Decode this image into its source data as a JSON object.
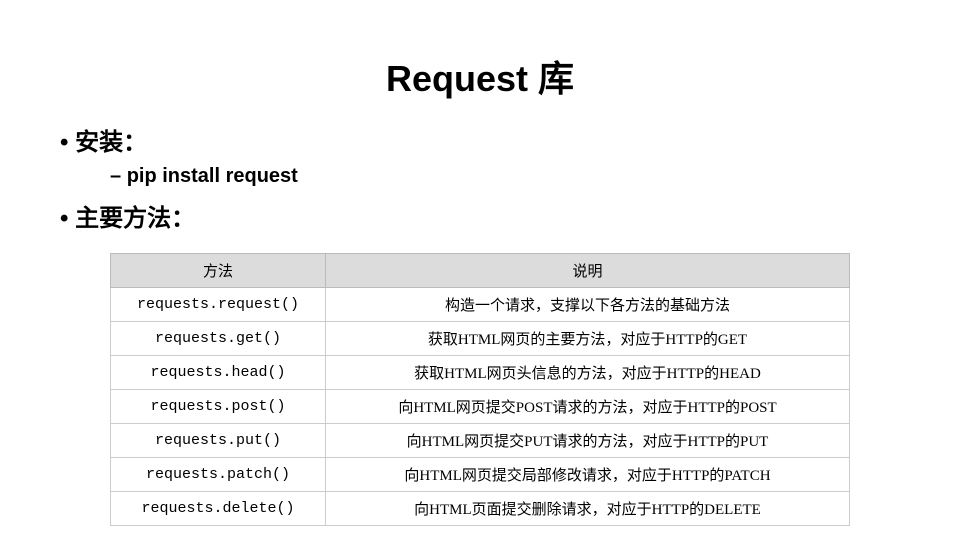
{
  "title": "Request 库",
  "bullets": {
    "install_label": "安装：",
    "install_cmd": "pip install request",
    "methods_label": "主要方法："
  },
  "table": {
    "headers": {
      "method": "方法",
      "desc": "说明"
    },
    "rows": [
      {
        "method": "requests.request()",
        "desc": "构造一个请求，支撑以下各方法的基础方法"
      },
      {
        "method": "requests.get()",
        "desc": "获取HTML网页的主要方法，对应于HTTP的GET"
      },
      {
        "method": "requests.head()",
        "desc": "获取HTML网页头信息的方法，对应于HTTP的HEAD"
      },
      {
        "method": "requests.post()",
        "desc": "向HTML网页提交POST请求的方法，对应于HTTP的POST"
      },
      {
        "method": "requests.put()",
        "desc": "向HTML网页提交PUT请求的方法，对应于HTTP的PUT"
      },
      {
        "method": "requests.patch()",
        "desc": "向HTML网页提交局部修改请求，对应于HTTP的PATCH"
      },
      {
        "method": "requests.delete()",
        "desc": "向HTML页面提交删除请求，对应于HTTP的DELETE"
      }
    ]
  }
}
